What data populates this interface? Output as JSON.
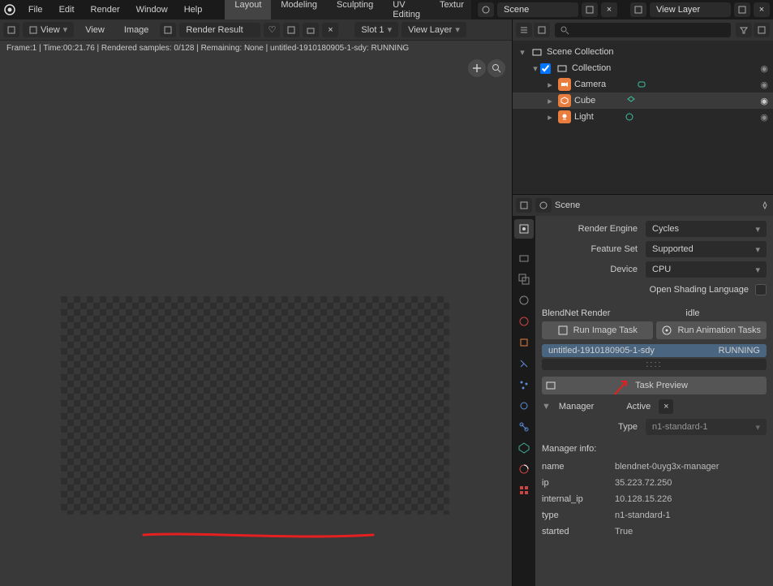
{
  "menus": [
    "File",
    "Edit",
    "Render",
    "Window",
    "Help"
  ],
  "tabs": [
    "Layout",
    "Modeling",
    "Sculpting",
    "UV Editing",
    "Textur"
  ],
  "active_tab": 0,
  "scene_name": "Scene",
  "view_layer": "View Layer",
  "header": {
    "view1": "View",
    "view2": "View",
    "image": "Image",
    "render_result": "Render Result",
    "slot": "Slot 1",
    "view_layer": "View Layer"
  },
  "status_line": "Frame:1 | Time:00:21.76 | Rendered samples: 0/128 | Remaining: None | untitled-1910180905-1-sdy: RUNNING",
  "outliner": {
    "scene_collection": "Scene Collection",
    "collection": "Collection",
    "camera": "Camera",
    "cube": "Cube",
    "light": "Light"
  },
  "props": {
    "scene": "Scene",
    "render_engine_label": "Render Engine",
    "render_engine": "Cycles",
    "feature_set_label": "Feature Set",
    "feature_set": "Supported",
    "device_label": "Device",
    "device": "CPU",
    "osl": "Open Shading Language",
    "blendnet": "BlendNet Render",
    "blendnet_status": "idle",
    "run_image": "Run Image Task",
    "run_anim": "Run Animation Tasks",
    "task_name": "untitled-1910180905-1-sdy",
    "task_status": "RUNNING",
    "task_preview": "Task Preview",
    "manager": "Manager",
    "active": "Active",
    "type_label": "Type",
    "type": "n1-standard-1",
    "mgr_info": "Manager info:",
    "info": [
      {
        "k": "name",
        "v": "blendnet-0uyg3x-manager"
      },
      {
        "k": "ip",
        "v": "35.223.72.250"
      },
      {
        "k": "internal_ip",
        "v": "10.128.15.226"
      },
      {
        "k": "type",
        "v": "n1-standard-1"
      },
      {
        "k": "started",
        "v": "True"
      }
    ]
  }
}
